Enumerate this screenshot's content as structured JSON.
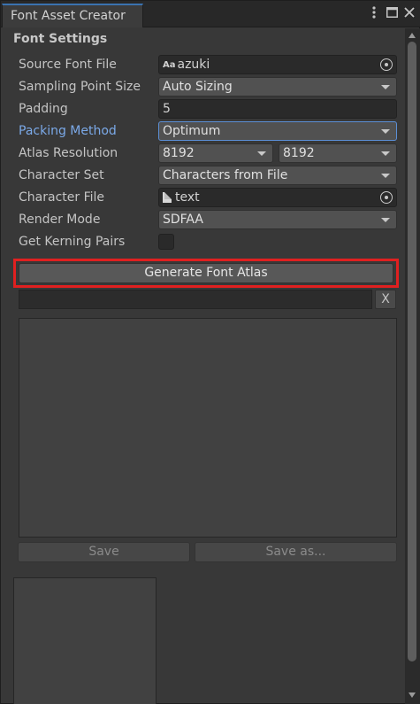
{
  "window": {
    "tab_title": "Font Asset Creator"
  },
  "section_title": "Font Settings",
  "fields": {
    "source_font_file": {
      "label": "Source Font File",
      "value": "azuki",
      "icon": "font-asset-icon",
      "icon_text": "Aa"
    },
    "sampling_point_size": {
      "label": "Sampling Point Size",
      "value": "Auto Sizing"
    },
    "padding": {
      "label": "Padding",
      "value": "5"
    },
    "packing_method": {
      "label": "Packing Method",
      "value": "Optimum"
    },
    "atlas_resolution": {
      "label": "Atlas Resolution",
      "width": "8192",
      "height": "8192"
    },
    "character_set": {
      "label": "Character Set",
      "value": "Characters from File"
    },
    "character_file": {
      "label": "Character File",
      "value": "text",
      "icon": "text-asset-icon"
    },
    "render_mode": {
      "label": "Render Mode",
      "value": "SDFAA"
    },
    "get_kerning_pairs": {
      "label": "Get Kerning Pairs",
      "checked": false
    }
  },
  "generate_button": "Generate Font Atlas",
  "progress_cancel": "X",
  "save_button": "Save",
  "save_as_button": "Save as...",
  "colors": {
    "highlight": "#e02020",
    "accent_label": "#7ba9e8",
    "tab_accent": "#3a72b0"
  }
}
